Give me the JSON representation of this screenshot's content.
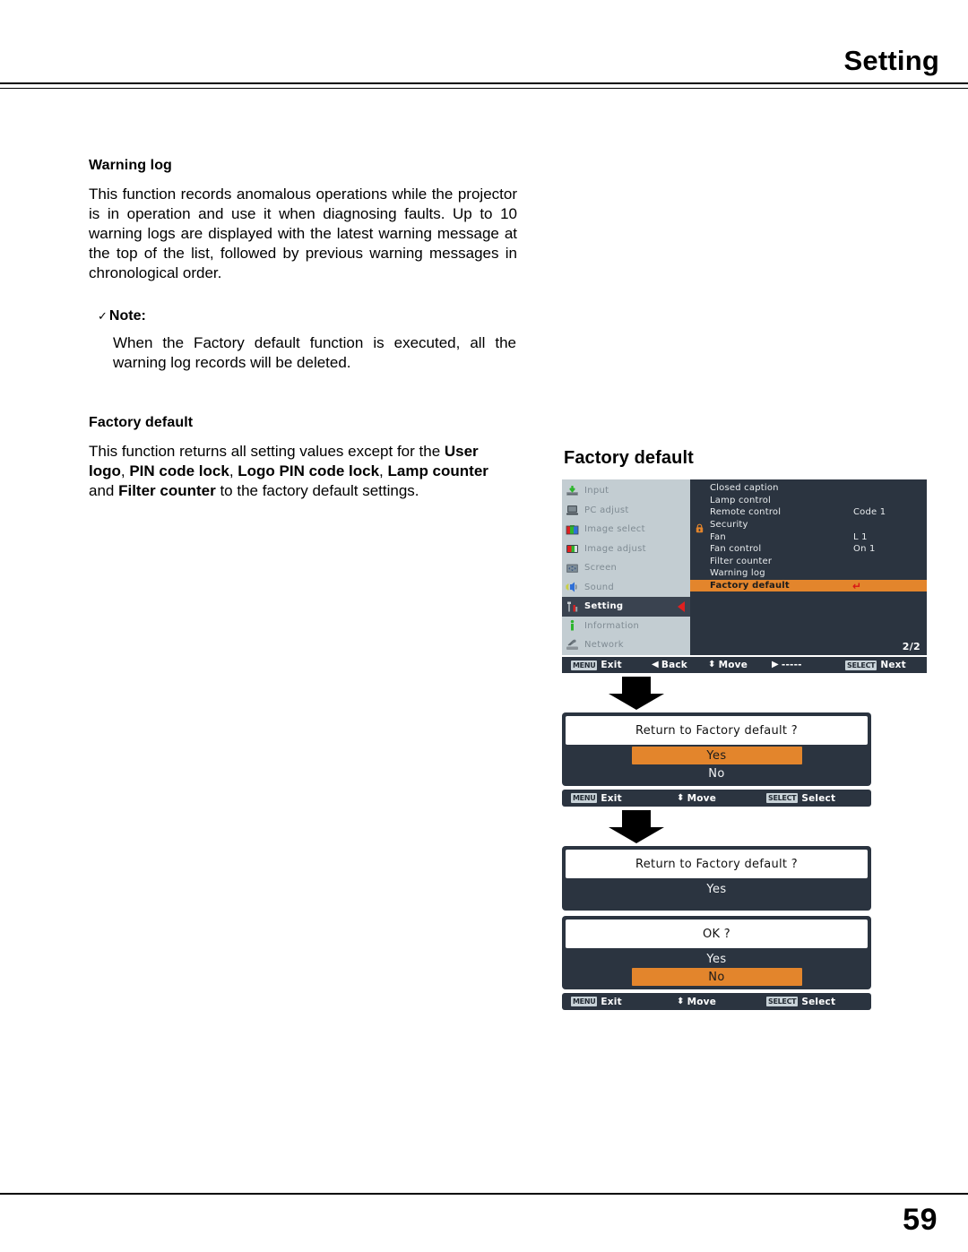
{
  "header": {
    "title": "Setting"
  },
  "footer": {
    "page_number": "59"
  },
  "warning_log": {
    "heading": "Warning log",
    "paragraph": "This function records anomalous operations while the projector is in operation and use it when diagnosing faults. Up to 10 warning logs are displayed with the latest warning message at the top of the list, followed by previous warning messages in chronological order.",
    "note_check": "✓",
    "note_label": "Note:",
    "note_body": "When the Factory default function is executed, all the warning log records will be deleted."
  },
  "factory_default": {
    "heading": "Factory default",
    "text_1": "This function returns all setting values except for the ",
    "bold_1": "User logo",
    "text_2": ", ",
    "bold_2": "PIN code lock",
    "text_3": ", ",
    "bold_3": "Logo PIN code lock",
    "text_4": ", ",
    "bold_4": "Lamp counter",
    "text_5": " and ",
    "bold_5": "Filter counter",
    "text_6": " to the factory default settings."
  },
  "figure": {
    "title": "Factory default",
    "osd": {
      "sidebar": [
        {
          "label": "Input",
          "icon": "input-icon",
          "active": false
        },
        {
          "label": "PC adjust",
          "icon": "pc-adjust-icon",
          "active": false
        },
        {
          "label": "Image select",
          "icon": "image-select-icon",
          "active": false
        },
        {
          "label": "Image adjust",
          "icon": "image-adjust-icon",
          "active": false
        },
        {
          "label": "Screen",
          "icon": "screen-icon",
          "active": false
        },
        {
          "label": "Sound",
          "icon": "sound-icon",
          "active": false
        },
        {
          "label": "Setting",
          "icon": "setting-icon",
          "active": true
        },
        {
          "label": "Information",
          "icon": "information-icon",
          "active": false
        },
        {
          "label": "Network",
          "icon": "network-icon",
          "active": false
        }
      ],
      "items": [
        {
          "label": "Closed caption",
          "value": "",
          "highlighted": false,
          "lock": false
        },
        {
          "label": "Lamp control",
          "value": "",
          "highlighted": false,
          "lock": false
        },
        {
          "label": "Remote control",
          "value": "Code 1",
          "highlighted": false,
          "lock": false
        },
        {
          "label": "Security",
          "value": "",
          "highlighted": false,
          "lock": true
        },
        {
          "label": "Fan",
          "value": "L 1",
          "highlighted": false,
          "lock": false
        },
        {
          "label": "Fan control",
          "value": "On 1",
          "highlighted": false,
          "lock": false
        },
        {
          "label": "Filter counter",
          "value": "",
          "highlighted": false,
          "lock": false
        },
        {
          "label": "Warning log",
          "value": "",
          "highlighted": false,
          "lock": false
        },
        {
          "label": "Factory default",
          "value": "",
          "highlighted": true,
          "lock": false,
          "return_arrow": "↵"
        }
      ],
      "page_indicator": "2/2",
      "hints": [
        {
          "key": "MENU",
          "glyph": "",
          "label": "Exit"
        },
        {
          "key": "",
          "glyph": "◀",
          "label": "Back"
        },
        {
          "key": "",
          "glyph": "⬍",
          "label": "Move"
        },
        {
          "key": "",
          "glyph": "▶",
          "label": "-----"
        },
        {
          "key": "SELECT",
          "glyph": "",
          "label": "Next"
        }
      ]
    },
    "dialog_1": {
      "question": "Return to Factory default ?",
      "options": [
        {
          "label": "Yes",
          "selected": true
        },
        {
          "label": "No",
          "selected": false
        }
      ],
      "hints": [
        {
          "key": "MENU",
          "glyph": "",
          "label": "Exit"
        },
        {
          "key": "",
          "glyph": "⬍",
          "label": "Move"
        },
        {
          "key": "SELECT",
          "glyph": "",
          "label": "Select"
        }
      ]
    },
    "dialog_2": {
      "question": "Return to Factory default ?",
      "options": [
        {
          "label": "Yes",
          "selected": false
        }
      ]
    },
    "dialog_3": {
      "question": "OK ?",
      "options": [
        {
          "label": "Yes",
          "selected": false
        },
        {
          "label": "No",
          "selected": true
        }
      ],
      "hints": [
        {
          "key": "MENU",
          "glyph": "",
          "label": "Exit"
        },
        {
          "key": "",
          "glyph": "⬍",
          "label": "Move"
        },
        {
          "key": "SELECT",
          "glyph": "",
          "label": "Select"
        }
      ]
    }
  },
  "colors": {
    "osd_bg": "#2b3440",
    "osd_sidebar_bg": "#c3cdd2",
    "highlight_orange": "#e3852c",
    "selected_row": "#3a4350",
    "arrow_red": "#e02020"
  }
}
